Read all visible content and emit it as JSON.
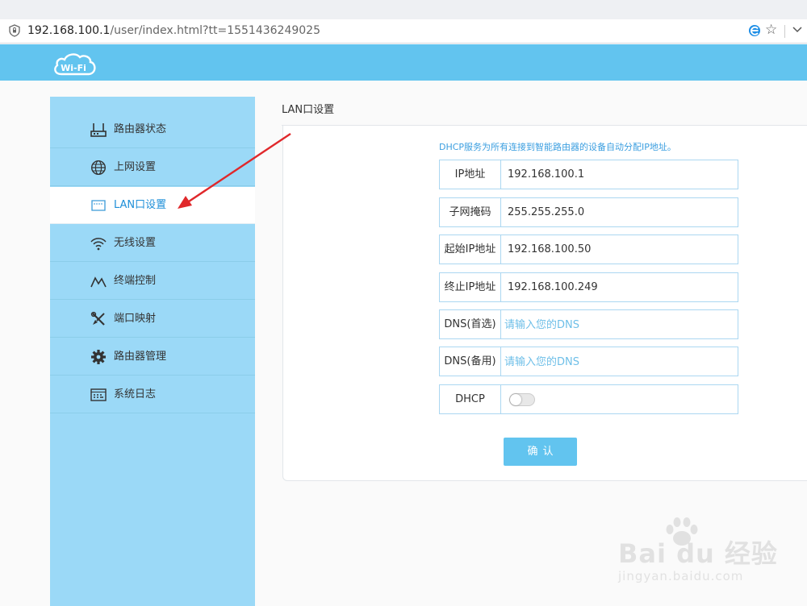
{
  "browser": {
    "url_host": "192.168.100.1",
    "url_path": "/user/index.html?tt=1551436249025"
  },
  "header": {
    "logo_text": "Wi-Fi"
  },
  "sidebar": {
    "items": [
      {
        "label": "路由器状态",
        "icon": "router-icon"
      },
      {
        "label": "上网设置",
        "icon": "globe-icon"
      },
      {
        "label": "LAN口设置",
        "icon": "lan-port-icon"
      },
      {
        "label": "无线设置",
        "icon": "wifi-icon"
      },
      {
        "label": "终端控制",
        "icon": "chart-line-icon"
      },
      {
        "label": "端口映射",
        "icon": "tools-icon"
      },
      {
        "label": "路由器管理",
        "icon": "gear-icon"
      },
      {
        "label": "系统日志",
        "icon": "log-icon"
      }
    ],
    "active_index": 2
  },
  "main": {
    "title": "LAN口设置",
    "hint": "DHCP服务为所有连接到智能路由器的设备自动分配IP地址。",
    "fields": {
      "ip": {
        "label": "IP地址",
        "value": "192.168.100.1"
      },
      "mask": {
        "label": "子网掩码",
        "value": "255.255.255.0"
      },
      "start_ip": {
        "label": "起始IP地址",
        "value": "192.168.100.50"
      },
      "end_ip": {
        "label": "终止IP地址",
        "value": "192.168.100.249"
      },
      "dns_primary": {
        "label": "DNS(首选)",
        "placeholder": "请输入您的DNS"
      },
      "dns_backup": {
        "label": "DNS(备用)",
        "placeholder": "请输入您的DNS"
      },
      "dhcp": {
        "label": "DHCP",
        "enabled": false
      }
    },
    "confirm_label": "确认"
  },
  "watermark": {
    "main": "Bai du 经验",
    "sub": "jingyan.baidu.com"
  },
  "colors": {
    "header": "#62c4ef",
    "sidebar": "#9bd9f7",
    "accent_text": "#1e8fd8",
    "field_border": "#abd7f1",
    "annotation_arrow": "#e0282b"
  }
}
